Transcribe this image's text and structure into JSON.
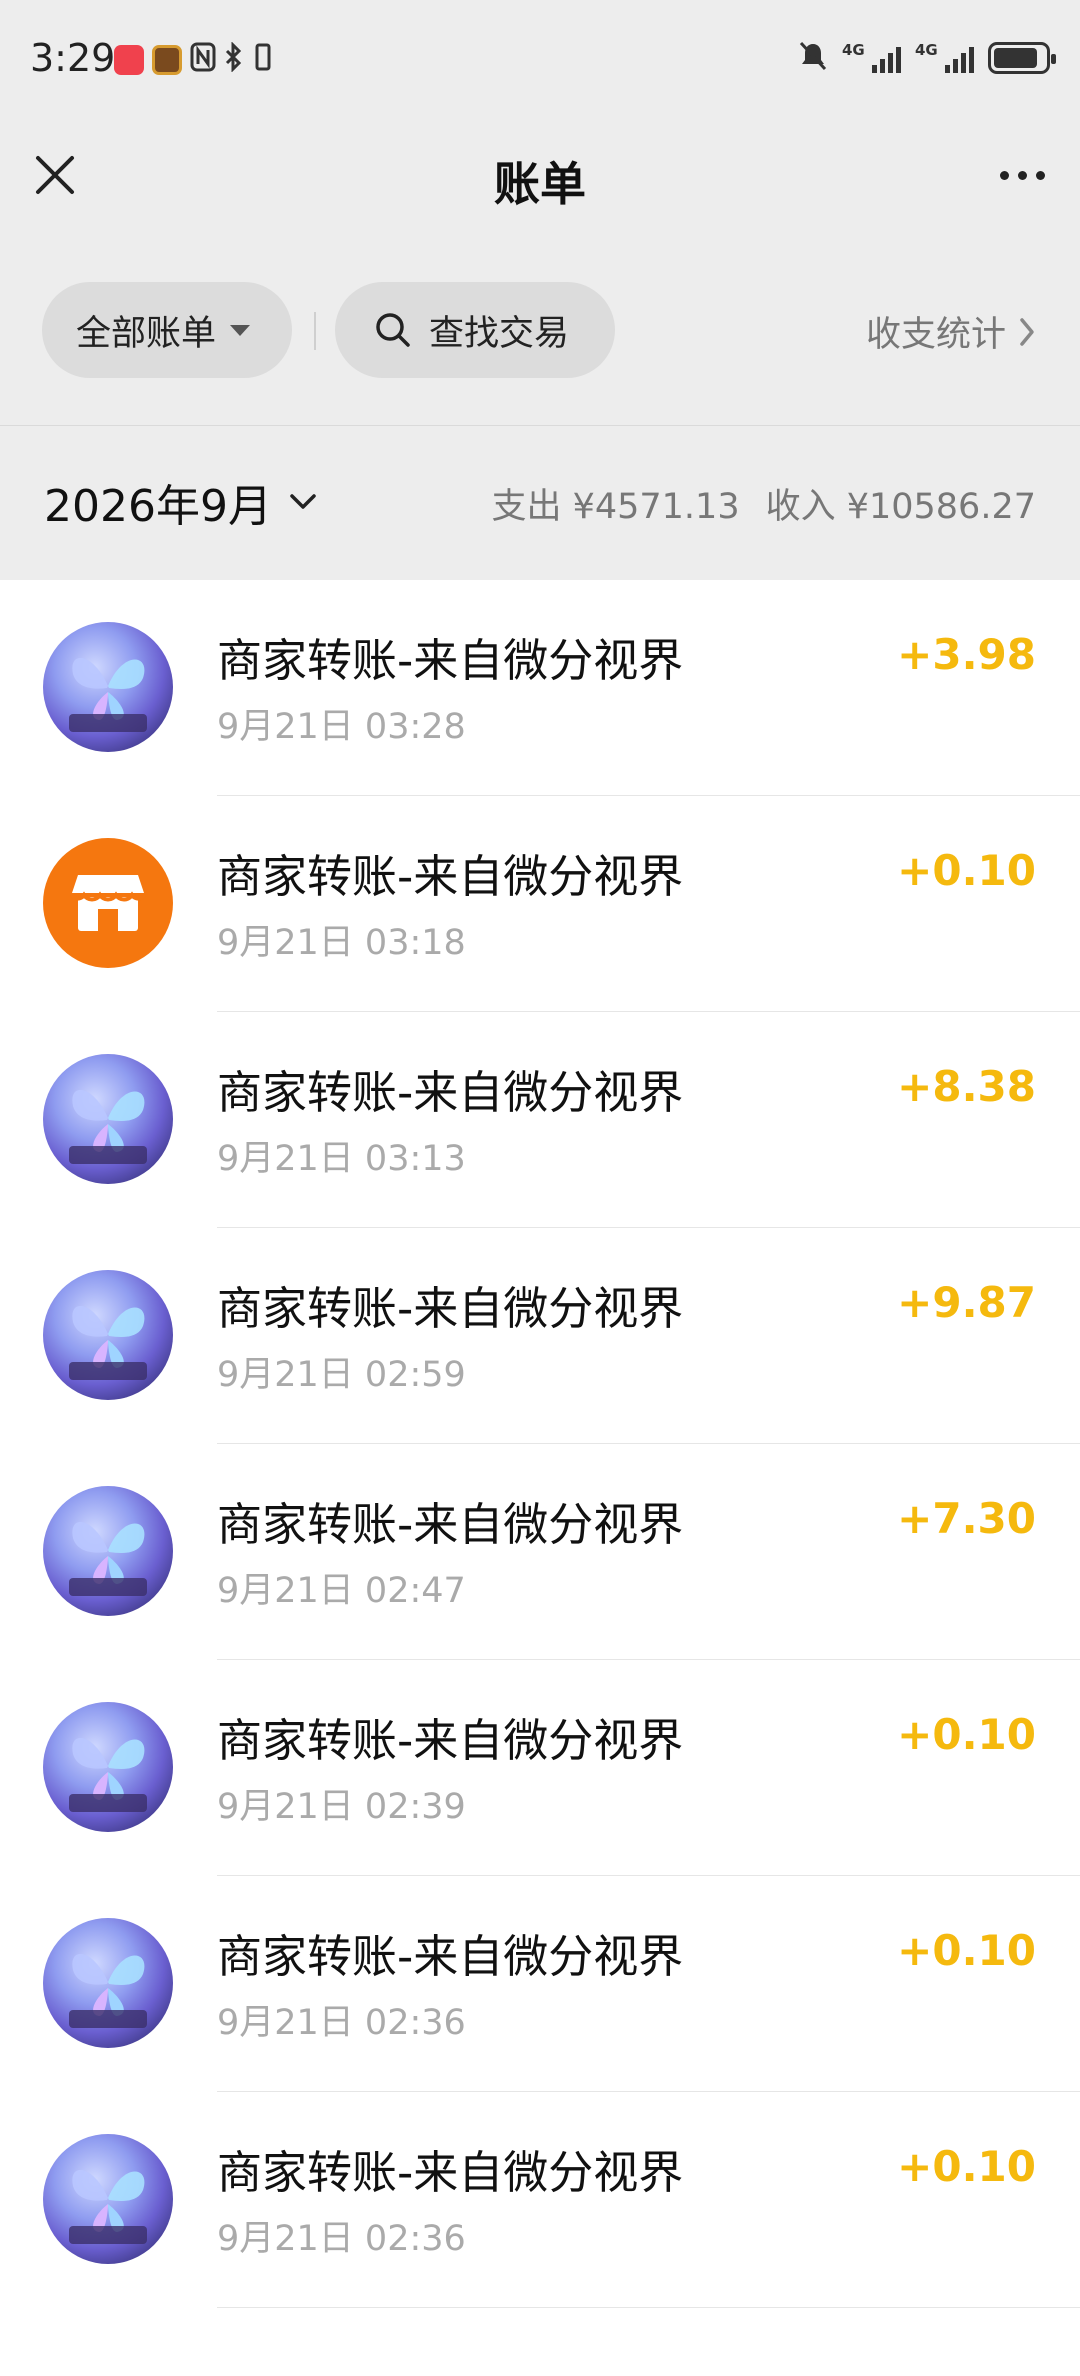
{
  "status_bar": {
    "time": "3:29",
    "network_1": "4G",
    "network_2": "4G",
    "battery_percent": 85,
    "icons": [
      "app-badge-red",
      "app-badge-game",
      "nfc-icon",
      "bluetooth-icon",
      "vibrate-icon",
      "mute-bell-icon",
      "signal-icon",
      "signal-icon",
      "battery-icon"
    ]
  },
  "nav": {
    "title": "账单",
    "close_icon": "close-icon",
    "more_icon": "more-icon"
  },
  "filter": {
    "all_bills_label": "全部账单",
    "search_label": "查找交易",
    "stats_label": "收支统计"
  },
  "month": {
    "label": "2026年9月",
    "expense": "支出 ¥4571.13",
    "income": "收入 ¥10586.27"
  },
  "colors": {
    "income_amount": "#f5b90e",
    "background": "#ededed",
    "pill": "#dcdcdc",
    "shop_avatar": "#f5770f"
  },
  "bills": [
    {
      "name": "商家转账-来自微分视界",
      "time": "9月21日 03:28",
      "amount": "+3.98",
      "avatar": "butterfly-avatar"
    },
    {
      "name": "商家转账-来自微分视界",
      "time": "9月21日 03:18",
      "amount": "+0.10",
      "avatar": "shop-icon"
    },
    {
      "name": "商家转账-来自微分视界",
      "time": "9月21日 03:13",
      "amount": "+8.38",
      "avatar": "butterfly-avatar"
    },
    {
      "name": "商家转账-来自微分视界",
      "time": "9月21日 02:59",
      "amount": "+9.87",
      "avatar": "butterfly-avatar"
    },
    {
      "name": "商家转账-来自微分视界",
      "time": "9月21日 02:47",
      "amount": "+7.30",
      "avatar": "butterfly-avatar"
    },
    {
      "name": "商家转账-来自微分视界",
      "time": "9月21日 02:39",
      "amount": "+0.10",
      "avatar": "butterfly-avatar"
    },
    {
      "name": "商家转账-来自微分视界",
      "time": "9月21日 02:36",
      "amount": "+0.10",
      "avatar": "butterfly-avatar"
    },
    {
      "name": "商家转账-来自微分视界",
      "time": "9月21日 02:36",
      "amount": "+0.10",
      "avatar": "butterfly-avatar"
    }
  ]
}
